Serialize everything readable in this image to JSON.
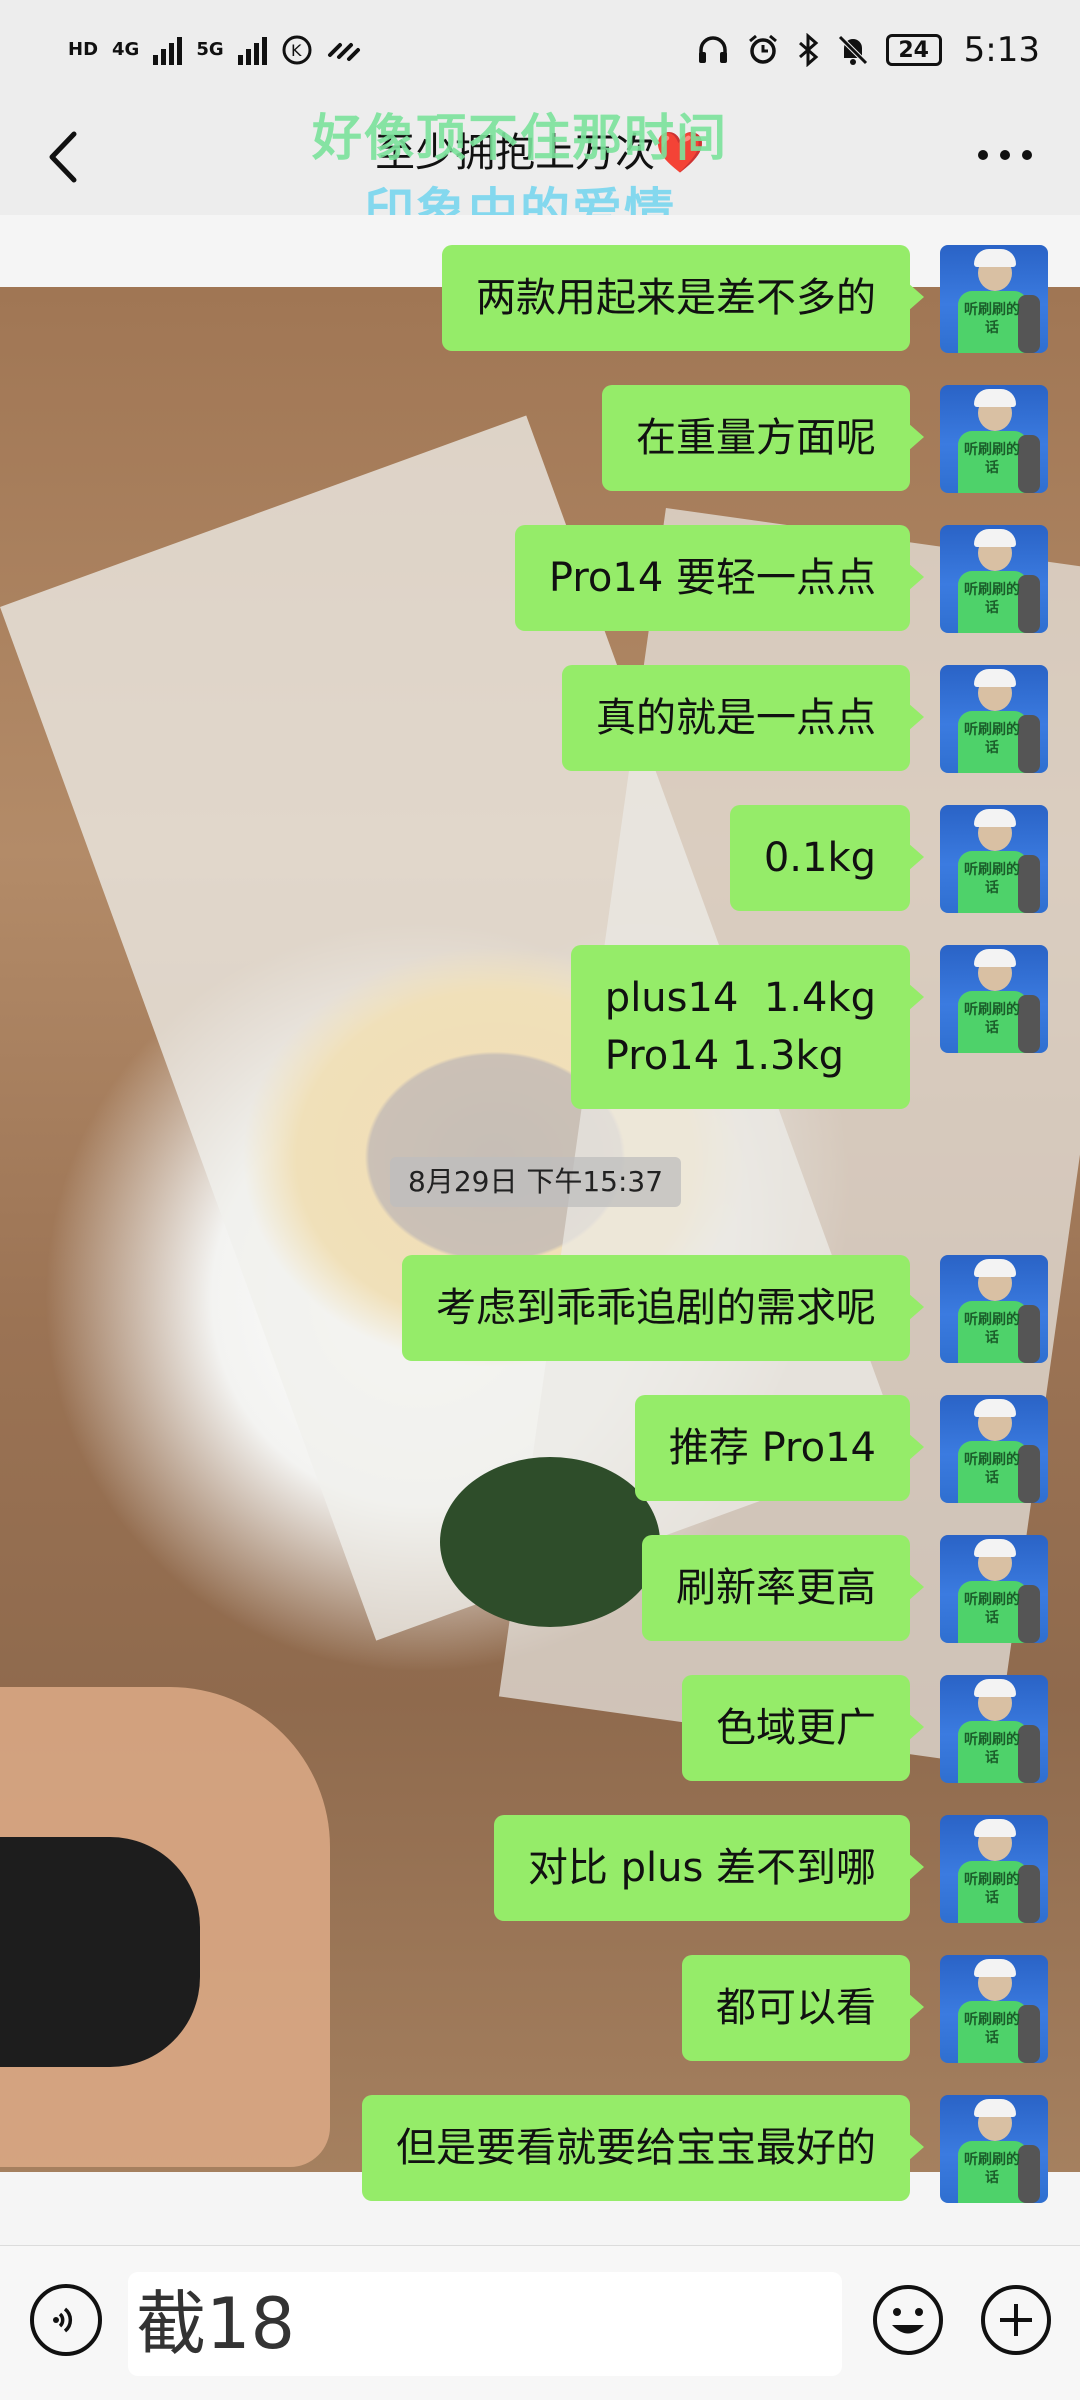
{
  "status_bar": {
    "left_tags": [
      "HD",
      "4G",
      "5G"
    ],
    "battery": "24",
    "time": "5:13"
  },
  "header": {
    "title": "至少拥抱上万次❤️",
    "lyric_line1": "好像顶不住那时间",
    "lyric_line2": "印象中的爱情"
  },
  "messages": [
    {
      "text": "两款用起来是差不多的"
    },
    {
      "text": "在重量方面呢"
    },
    {
      "text": "Pro14 要轻一点点"
    },
    {
      "text": "真的就是一点点"
    },
    {
      "text": "0.1kg"
    },
    {
      "text": "plus14  1.4kg\nPro14 1.3kg"
    },
    {
      "text": "考虑到乖乖追剧的需求呢"
    },
    {
      "text": "推荐 Pro14"
    },
    {
      "text": "刷新率更高"
    },
    {
      "text": "色域更广"
    },
    {
      "text": "对比 plus 差不到哪"
    },
    {
      "text": "都可以看"
    },
    {
      "text": "但是要看就要给宝宝最好的"
    }
  ],
  "timestamp": "8月29日 下午15:37",
  "avatar_text": "听刷刷的话",
  "input": {
    "value": "截18"
  },
  "colors": {
    "bubble": "#95ec69",
    "background": "#ededed"
  }
}
